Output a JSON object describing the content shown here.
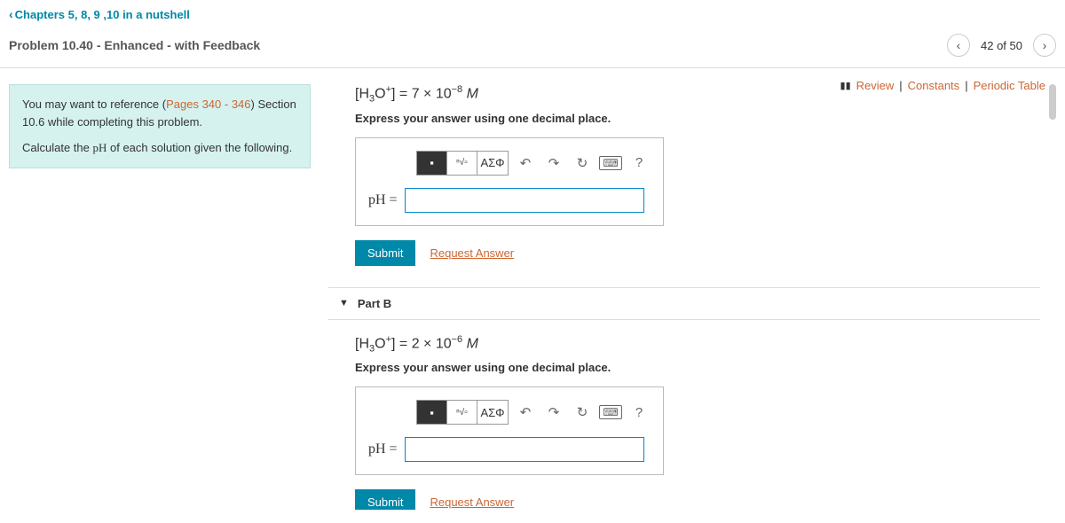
{
  "nav": {
    "back_text": "Chapters 5, 8, 9 ,10 in a nutshell",
    "problem_title": "Problem 10.40 - Enhanced - with Feedback",
    "counter": "42 of 50"
  },
  "top_links": {
    "review": "Review",
    "constants": "Constants",
    "periodic": "Periodic Table"
  },
  "hint": {
    "line1a": "You may want to reference (",
    "pages": "Pages 340 - 346",
    "line1b": ") Section 10.6 while completing this problem.",
    "line2a": "Calculate the ",
    "ph": "pH",
    "line2b": " of each solution given the following."
  },
  "partA": {
    "eq_pre": "[H",
    "eq_sub": "3",
    "eq_mid": "O",
    "eq_sup": "+",
    "eq_post": "] = 7 × 10",
    "eq_exp": "−8",
    "eq_unit": " M",
    "instruction": "Express your answer using one decimal place.",
    "greek": "ΑΣΦ",
    "label": "pH =",
    "submit": "Submit",
    "request": "Request Answer"
  },
  "partB": {
    "header": "Part B",
    "eq_pre": "[H",
    "eq_sub": "3",
    "eq_mid": "O",
    "eq_sup": "+",
    "eq_post": "] = 2 × 10",
    "eq_exp": "−6",
    "eq_unit": " M",
    "instruction": "Express your answer using one decimal place.",
    "greek": "ΑΣΦ",
    "label": "pH =",
    "submit": "Submit",
    "request": "Request Answer"
  },
  "tool_help": "?"
}
